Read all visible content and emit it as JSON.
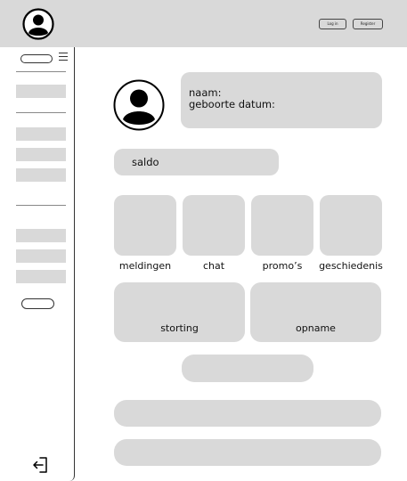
{
  "header": {
    "login_label": "Log in",
    "register_label": "Register"
  },
  "sidebar": {
    "icons": [
      "menu-icon",
      "logout-icon"
    ]
  },
  "profile": {
    "name_label": "naam:",
    "birthdate_label": "geboorte datum:"
  },
  "balance": {
    "label": "saldo"
  },
  "tiles": [
    {
      "label": "meldingen"
    },
    {
      "label": "chat"
    },
    {
      "label": "promo’s"
    },
    {
      "label": "geschiedenis"
    }
  ],
  "actions": [
    {
      "label": "storting"
    },
    {
      "label": "opname"
    }
  ],
  "colors": {
    "panel": "#d9d9d9",
    "outline": "#333333"
  }
}
